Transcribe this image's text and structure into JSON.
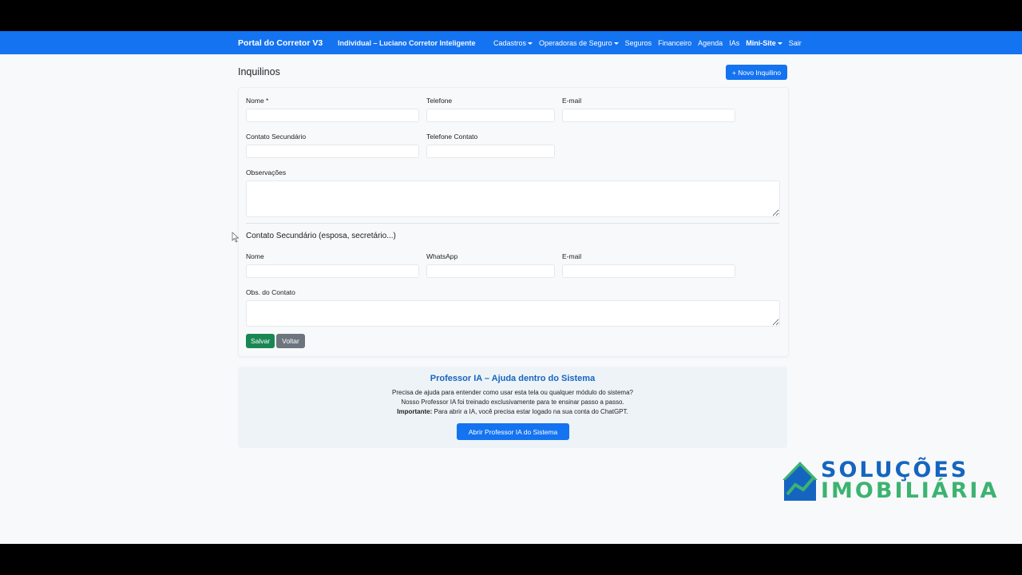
{
  "navbar": {
    "brand": "Portal do Corretor V3",
    "user": "Individual – Luciano Corretor Inteligente",
    "items": [
      {
        "label": "Cadastros",
        "dropdown": true
      },
      {
        "label": "Operadoras de Seguro",
        "dropdown": true
      },
      {
        "label": "Seguros",
        "dropdown": false
      },
      {
        "label": "Financeiro",
        "dropdown": false
      },
      {
        "label": "Agenda",
        "dropdown": false
      },
      {
        "label": "IAs",
        "dropdown": false
      },
      {
        "label": "Mini-Site",
        "dropdown": true
      },
      {
        "label": "Sair",
        "dropdown": false
      }
    ]
  },
  "page": {
    "title": "Inquilinos",
    "new_button": "+ Novo Inquilino"
  },
  "form": {
    "nome_label": "Nome *",
    "telefone_label": "Telefone",
    "email_label": "E-mail",
    "contato_secundario_label": "Contato Secundário",
    "telefone_contato_label": "Telefone Contato",
    "observacoes_label": "Observações",
    "section_title": "Contato Secundário (esposa, secretário...)",
    "sec_nome_label": "Nome",
    "sec_whatsapp_label": "WhatsApp",
    "sec_email_label": "E-mail",
    "sec_obs_label": "Obs. do Contato",
    "save_button": "Salvar",
    "back_button": "Voltar"
  },
  "help": {
    "title": "Professor IA – Ajuda dentro do Sistema",
    "line1": "Precisa de ajuda para entender como usar esta tela ou qualquer módulo do sistema?",
    "line2": "Nosso Professor IA foi treinado exclusivamente para te ensinar passo a passo.",
    "line3_bold": "Importante:",
    "line3": " Para abrir a IA, você precisa estar logado na sua conta do ChatGPT.",
    "button": "Abrir Professor IA do Sistema"
  },
  "watermark": {
    "line1": "SOLUÇÕES",
    "line2": "IMOBILIÁRIA",
    "colors": {
      "blue": "#1565c0",
      "green": "#3cb371"
    }
  },
  "colors": {
    "primary": "#1473f0",
    "success": "#198754",
    "secondary": "#6c757d"
  }
}
